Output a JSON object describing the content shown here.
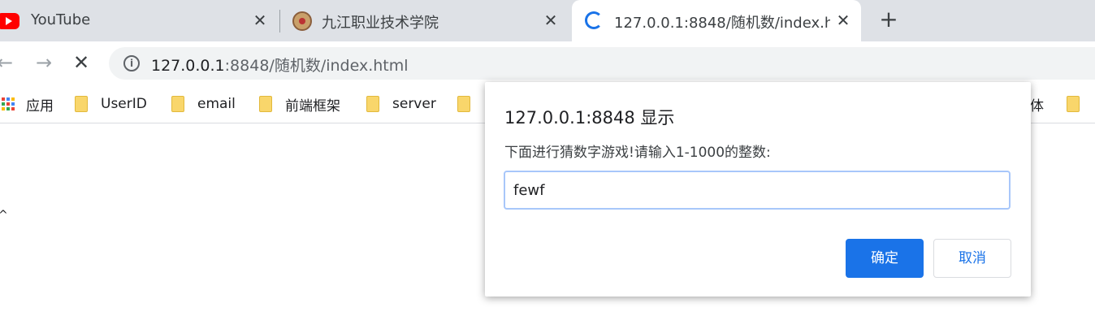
{
  "tabs": [
    {
      "title": "YouTube"
    },
    {
      "title": "九江职业技术学院"
    },
    {
      "title": "127.0.0.1:8848/随机数/index.ht"
    }
  ],
  "toolbar": {
    "url_host": "127.0.0.1",
    "url_rest": ":8848/随机数/index.html"
  },
  "bookmarks": {
    "apps_label": "应用",
    "items": [
      "UserID",
      "email",
      "前端框架",
      "server"
    ],
    "partial_right": "体"
  },
  "dialog": {
    "title": "127.0.0.1:8848 显示",
    "message": "下面进行猜数字游戏!请输入1-1000的整数:",
    "input_value": "fewf",
    "ok_label": "确定",
    "cancel_label": "取消"
  },
  "colors": {
    "accent": "#1a73e8",
    "youtube_red": "#ff0000",
    "folder": "#f9d66b"
  }
}
